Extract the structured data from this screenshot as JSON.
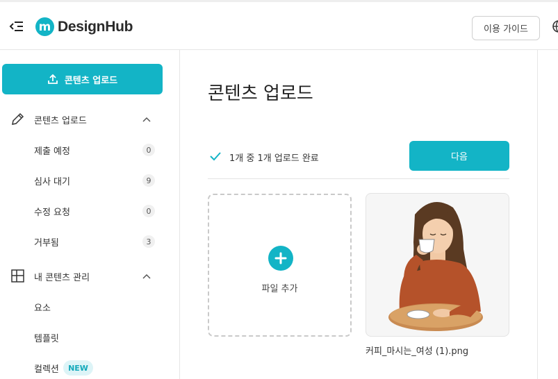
{
  "header": {
    "logo_mark": "m",
    "logo_text": "DesignHub",
    "guide_button": "이용 가이드",
    "icons": [
      "menu-collapse-icon",
      "globe-icon"
    ]
  },
  "sidebar": {
    "upload_button": "콘텐츠 업로드",
    "section_upload": {
      "label": "콘텐츠 업로드",
      "icon": "pencil-icon",
      "items": [
        {
          "label": "제출 예정",
          "count": "0"
        },
        {
          "label": "심사 대기",
          "count": "9"
        },
        {
          "label": "수정 요청",
          "count": "0"
        },
        {
          "label": "거부됨",
          "count": "3"
        }
      ]
    },
    "section_manage": {
      "label": "내 콘텐츠 관리",
      "icon": "grid-layout-icon",
      "items": [
        {
          "label": "요소"
        },
        {
          "label": "템플릿"
        },
        {
          "label": "컬렉션",
          "badge": "NEW"
        }
      ]
    }
  },
  "main": {
    "title": "콘텐츠 업로드",
    "status_text": "1개 중 1개 업로드 완료",
    "next_button": "다음",
    "add_file_label": "파일 추가",
    "file_name": "커피_마시는_여성 (1).png"
  },
  "colors": {
    "accent": "#13b4c6",
    "badge_bg": "#ddf4f7"
  }
}
